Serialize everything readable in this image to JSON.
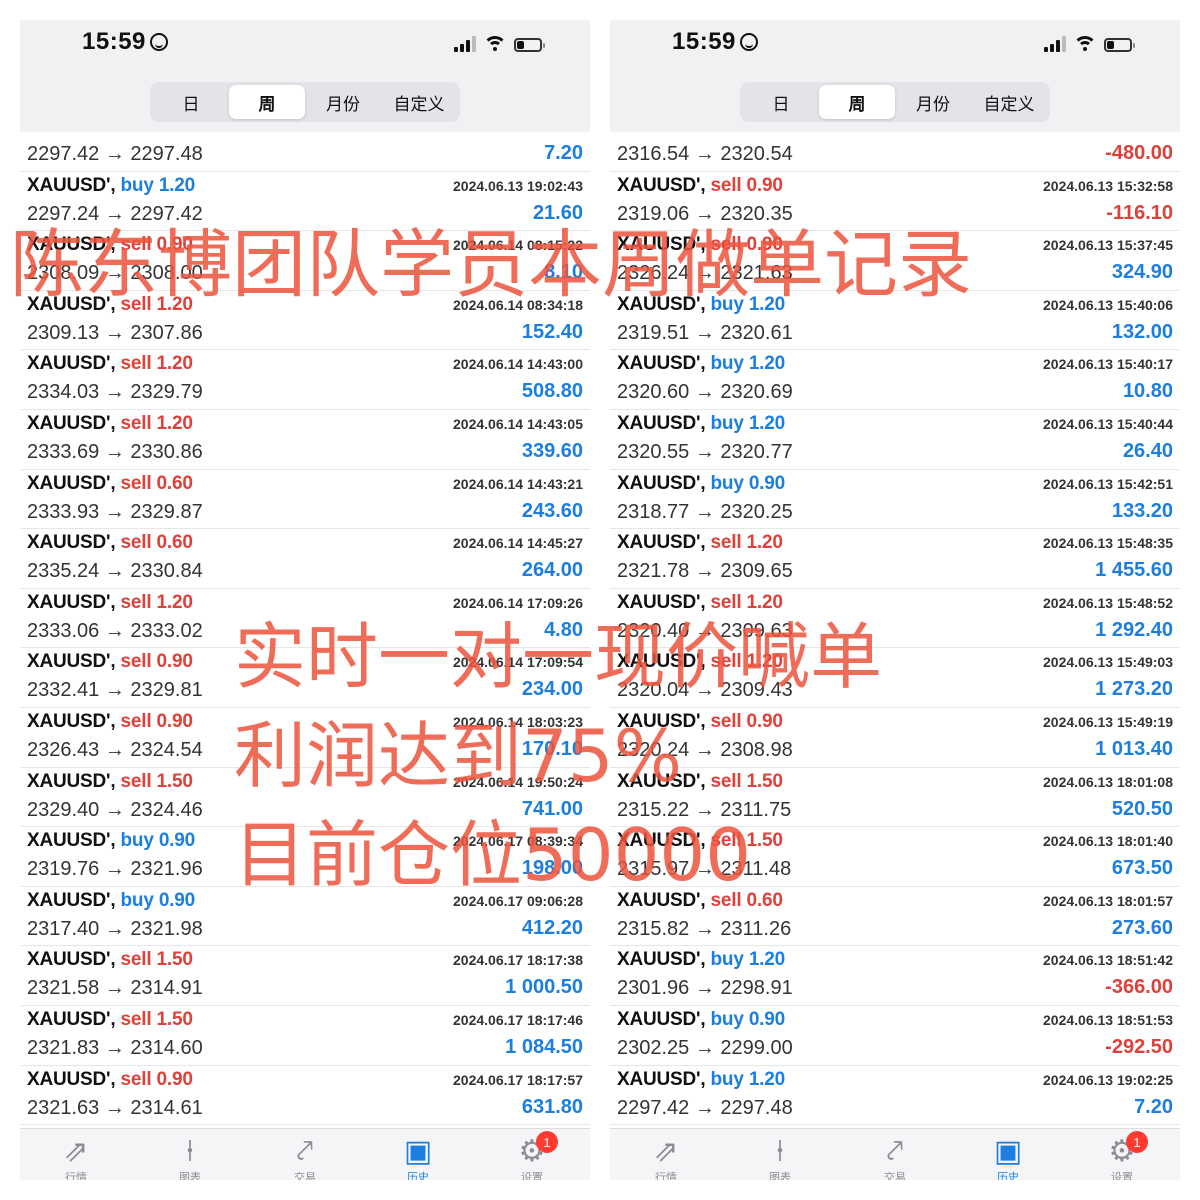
{
  "status": {
    "time": "15:59"
  },
  "segments": [
    "日",
    "周",
    "月份",
    "自定义"
  ],
  "active_segment": 1,
  "tabs": [
    {
      "label": "行情",
      "icon": "⇗"
    },
    {
      "label": "图表",
      "icon": "⍿"
    },
    {
      "label": "交易",
      "icon": "⤤"
    },
    {
      "label": "历史",
      "icon": "▣"
    },
    {
      "label": "设置",
      "icon": "⚙"
    }
  ],
  "settings_badge": "1",
  "overlay": {
    "title": "陈东博团队学员本周做单记录",
    "line1": "实时一对一现价喊单",
    "line2": "利润达到75%",
    "line3": "目前仓位50000"
  },
  "left_list": [
    {
      "symbol": "",
      "side": "",
      "lot": "",
      "time": "",
      "prices": "2297.42 → 2297.48",
      "profit": "7.20"
    },
    {
      "symbol": "XAUUSD',",
      "side": "buy",
      "lot": "1.20",
      "time": "2024.06.13 19:02:43",
      "prices": "2297.24 → 2297.42",
      "profit": "21.60"
    },
    {
      "symbol": "XAUUSD',",
      "side": "sell",
      "lot": "0.90",
      "time": "2024.06.14 08:15:22",
      "prices": "2308.09 → 2308.00",
      "profit": "8.10"
    },
    {
      "symbol": "XAUUSD',",
      "side": "sell",
      "lot": "1.20",
      "time": "2024.06.14 08:34:18",
      "prices": "2309.13 → 2307.86",
      "profit": "152.40"
    },
    {
      "symbol": "XAUUSD',",
      "side": "sell",
      "lot": "1.20",
      "time": "2024.06.14 14:43:00",
      "prices": "2334.03 → 2329.79",
      "profit": "508.80"
    },
    {
      "symbol": "XAUUSD',",
      "side": "sell",
      "lot": "1.20",
      "time": "2024.06.14 14:43:05",
      "prices": "2333.69 → 2330.86",
      "profit": "339.60"
    },
    {
      "symbol": "XAUUSD',",
      "side": "sell",
      "lot": "0.60",
      "time": "2024.06.14 14:43:21",
      "prices": "2333.93 → 2329.87",
      "profit": "243.60"
    },
    {
      "symbol": "XAUUSD',",
      "side": "sell",
      "lot": "0.60",
      "time": "2024.06.14 14:45:27",
      "prices": "2335.24 → 2330.84",
      "profit": "264.00"
    },
    {
      "symbol": "XAUUSD',",
      "side": "sell",
      "lot": "1.20",
      "time": "2024.06.14 17:09:26",
      "prices": "2333.06 → 2333.02",
      "profit": "4.80"
    },
    {
      "symbol": "XAUUSD',",
      "side": "sell",
      "lot": "0.90",
      "time": "2024.06.14 17:09:54",
      "prices": "2332.41 → 2329.81",
      "profit": "234.00"
    },
    {
      "symbol": "XAUUSD',",
      "side": "sell",
      "lot": "0.90",
      "time": "2024.06.14 18:03:23",
      "prices": "2326.43 → 2324.54",
      "profit": "170.10"
    },
    {
      "symbol": "XAUUSD',",
      "side": "sell",
      "lot": "1.50",
      "time": "2024.06.14 19:50:24",
      "prices": "2329.40 → 2324.46",
      "profit": "741.00"
    },
    {
      "symbol": "XAUUSD',",
      "side": "buy",
      "lot": "0.90",
      "time": "2024.06.17 08:39:34",
      "prices": "2319.76 → 2321.96",
      "profit": "198.00"
    },
    {
      "symbol": "XAUUSD',",
      "side": "buy",
      "lot": "0.90",
      "time": "2024.06.17 09:06:28",
      "prices": "2317.40 → 2321.98",
      "profit": "412.20"
    },
    {
      "symbol": "XAUUSD',",
      "side": "sell",
      "lot": "1.50",
      "time": "2024.06.17 18:17:38",
      "prices": "2321.58 → 2314.91",
      "profit": "1 000.50"
    },
    {
      "symbol": "XAUUSD',",
      "side": "sell",
      "lot": "1.50",
      "time": "2024.06.17 18:17:46",
      "prices": "2321.83 → 2314.60",
      "profit": "1 084.50"
    },
    {
      "symbol": "XAUUSD',",
      "side": "sell",
      "lot": "0.90",
      "time": "2024.06.17 18:17:57",
      "prices": "2321.63 → 2314.61",
      "profit": "631.80"
    }
  ],
  "right_list": [
    {
      "symbol": "",
      "side": "",
      "lot": "",
      "time": "",
      "prices": "2316.54 → 2320.54",
      "profit": "-480.00"
    },
    {
      "symbol": "XAUUSD',",
      "side": "sell",
      "lot": "0.90",
      "time": "2024.06.13 15:32:58",
      "prices": "2319.06 → 2320.35",
      "profit": "-116.10"
    },
    {
      "symbol": "XAUUSD',",
      "side": "sell",
      "lot": "0.90",
      "time": "2024.06.13 15:37:45",
      "prices": "2326.24 → 2321.63",
      "profit": "324.90"
    },
    {
      "symbol": "XAUUSD',",
      "side": "buy",
      "lot": "1.20",
      "time": "2024.06.13 15:40:06",
      "prices": "2319.51 → 2320.61",
      "profit": "132.00"
    },
    {
      "symbol": "XAUUSD',",
      "side": "buy",
      "lot": "1.20",
      "time": "2024.06.13 15:40:17",
      "prices": "2320.60 → 2320.69",
      "profit": "10.80"
    },
    {
      "symbol": "XAUUSD',",
      "side": "buy",
      "lot": "1.20",
      "time": "2024.06.13 15:40:44",
      "prices": "2320.55 → 2320.77",
      "profit": "26.40"
    },
    {
      "symbol": "XAUUSD',",
      "side": "buy",
      "lot": "0.90",
      "time": "2024.06.13 15:42:51",
      "prices": "2318.77 → 2320.25",
      "profit": "133.20"
    },
    {
      "symbol": "XAUUSD',",
      "side": "sell",
      "lot": "1.20",
      "time": "2024.06.13 15:48:35",
      "prices": "2321.78 → 2309.65",
      "profit": "1 455.60"
    },
    {
      "symbol": "XAUUSD',",
      "side": "sell",
      "lot": "1.20",
      "time": "2024.06.13 15:48:52",
      "prices": "2320.40 → 2309.63",
      "profit": "1 292.40"
    },
    {
      "symbol": "XAUUSD',",
      "side": "sell",
      "lot": "1.20",
      "time": "2024.06.13 15:49:03",
      "prices": "2320.04 → 2309.43",
      "profit": "1 273.20"
    },
    {
      "symbol": "XAUUSD',",
      "side": "sell",
      "lot": "0.90",
      "time": "2024.06.13 15:49:19",
      "prices": "2320.24 → 2308.98",
      "profit": "1 013.40"
    },
    {
      "symbol": "XAUUSD',",
      "side": "sell",
      "lot": "1.50",
      "time": "2024.06.13 18:01:08",
      "prices": "2315.22 → 2311.75",
      "profit": "520.50"
    },
    {
      "symbol": "XAUUSD',",
      "side": "sell",
      "lot": "1.50",
      "time": "2024.06.13 18:01:40",
      "prices": "2315.97 → 2311.48",
      "profit": "673.50"
    },
    {
      "symbol": "XAUUSD',",
      "side": "sell",
      "lot": "0.60",
      "time": "2024.06.13 18:01:57",
      "prices": "2315.82 → 2311.26",
      "profit": "273.60"
    },
    {
      "symbol": "XAUUSD',",
      "side": "buy",
      "lot": "1.20",
      "time": "2024.06.13 18:51:42",
      "prices": "2301.96 → 2298.91",
      "profit": "-366.00"
    },
    {
      "symbol": "XAUUSD',",
      "side": "buy",
      "lot": "0.90",
      "time": "2024.06.13 18:51:53",
      "prices": "2302.25 → 2299.00",
      "profit": "-292.50"
    },
    {
      "symbol": "XAUUSD',",
      "side": "buy",
      "lot": "1.20",
      "time": "2024.06.13 19:02:25",
      "prices": "2297.42 → 2297.48",
      "profit": "7.20"
    }
  ]
}
